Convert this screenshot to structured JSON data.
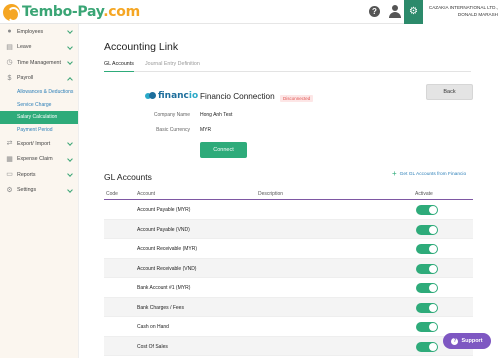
{
  "app": {
    "logo_main": "Tembo-Pay",
    "logo_suffix": ".com",
    "company": "CAZAKIA INTERNATIONAL LTD., DONALD MARASH"
  },
  "sidebar": {
    "items": [
      {
        "label": "Employees",
        "icon": "employees-icon"
      },
      {
        "label": "Leave",
        "icon": "leave-icon"
      },
      {
        "label": "Time Management",
        "icon": "clock-icon"
      },
      {
        "label": "Payroll",
        "icon": "payroll-icon"
      },
      {
        "label": "Export/ Import",
        "icon": "export-icon"
      },
      {
        "label": "Expense Claim",
        "icon": "expense-icon"
      },
      {
        "label": "Reports",
        "icon": "reports-icon"
      },
      {
        "label": "Settings",
        "icon": "settings-icon"
      }
    ],
    "payroll_sub": [
      {
        "label": "Allowances & Deductions"
      },
      {
        "label": "Service Charge"
      },
      {
        "label": "Salary Calculation"
      },
      {
        "label": "Payment Period"
      }
    ]
  },
  "main": {
    "title": "Accounting Link",
    "tabs": [
      {
        "label": "GL Accounts"
      },
      {
        "label": "Journal Entry Definition"
      }
    ],
    "connection": {
      "logo_main": "financ",
      "logo_suffix": "io",
      "title": "Financio Connection",
      "status": "Disconnected",
      "company_label": "Company Name",
      "company_value": "Hong Anh Test",
      "currency_label": "Basic Currency",
      "currency_value": "MYR",
      "connect_label": "Connect",
      "back_label": "Back"
    },
    "gl": {
      "title": "GL Accounts",
      "add_label": "Get GL Accounts from Financio",
      "columns": {
        "code": "Code",
        "account": "Account",
        "description": "Description",
        "activate": "Activate"
      },
      "rows": [
        {
          "account": "Account Payable (MYR)",
          "active": true
        },
        {
          "account": "Account Payable (VND)",
          "active": true
        },
        {
          "account": "Account Receivable (MYR)",
          "active": true
        },
        {
          "account": "Account Receivable (VND)",
          "active": true
        },
        {
          "account": "Bank Account #1 (MYR)",
          "active": true
        },
        {
          "account": "Bank Charges / Fees",
          "active": true
        },
        {
          "account": "Cash on Hand",
          "active": true
        },
        {
          "account": "Cost Of Sales",
          "active": true
        }
      ]
    }
  },
  "support_label": "Support",
  "colors": {
    "brand_green": "#2eab7a",
    "brand_orange": "#f5a623",
    "accent_purple": "#7e57c2",
    "link_blue": "#2c7fb8"
  }
}
